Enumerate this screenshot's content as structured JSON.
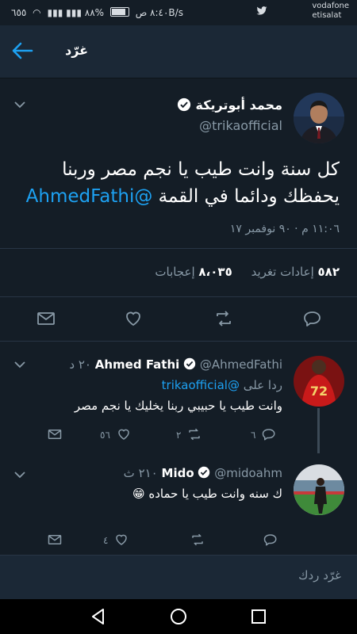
{
  "status_bar": {
    "time": "٨:٤٠ ص",
    "battery": "%٨٨",
    "network_speed": "٦٥٥B/s",
    "carrier_line1": "vodafone",
    "carrier_line2": "etisalat"
  },
  "header": {
    "title": "غرّد"
  },
  "main_tweet": {
    "author_name": "محمد أبوتريكة",
    "handle": "@trikaofficial",
    "text_line1": "كل سنة وانت طيب يا نجم مصر وربنا",
    "text_line2_prefix": "يحفظك ودائما في القمة",
    "mention": "@AhmedFathi",
    "date": "١١:٠٦ م · ٩٠ نوفمبر ١٧",
    "retweets_count": "٥٨٢",
    "retweets_label": "إعادات تغريد",
    "likes_count": "٨،٠٣٥",
    "likes_label": "إعجابات"
  },
  "replies": [
    {
      "name": "Ahmed Fathi",
      "handle": "@AhmedFathi",
      "time": "٢٠ د",
      "context_label": "ردا على",
      "context_handle": "@trikaofficial",
      "text": "وانت طيب يا حبيبي ربنا يخليك يا نجم مصر",
      "reply_count": "٦",
      "retweet_count": "٢",
      "like_count": "٥٦"
    },
    {
      "name": "Mido",
      "handle": "@midoahm",
      "time": "٢١٠ ث",
      "text": "ك سنه وانت طيب يا حماده 😁",
      "like_count": "٤"
    }
  ],
  "reply_box": {
    "placeholder": "غرّد ردك"
  },
  "colors": {
    "background": "#141d26",
    "accent": "#1da1f2",
    "muted": "#8899a6",
    "bar": "#1b2836"
  },
  "icons": [
    "back-arrow-icon",
    "verified-icon",
    "chevron-down-icon",
    "reply-icon",
    "retweet-icon",
    "like-icon",
    "message-icon",
    "nav-back-icon",
    "nav-home-icon",
    "nav-recents-icon",
    "twitter-bird-icon"
  ]
}
